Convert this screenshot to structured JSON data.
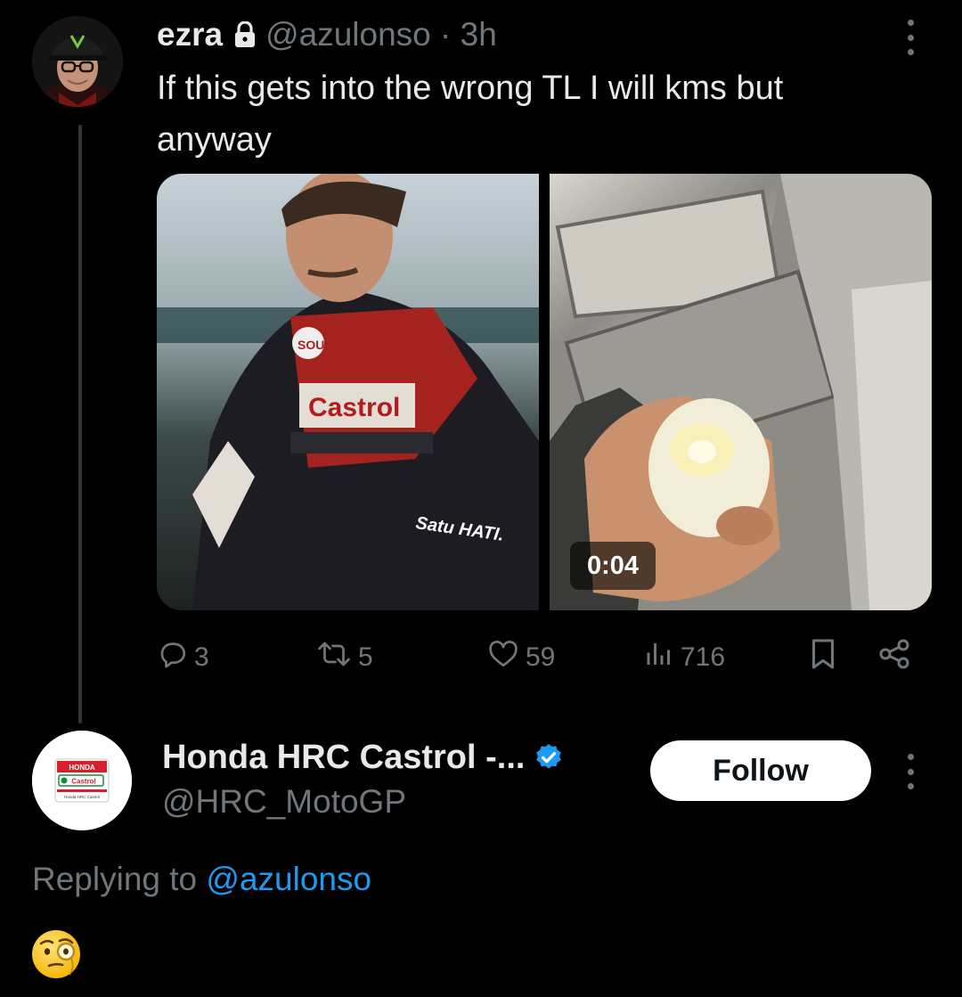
{
  "post": {
    "display_name": "ezra",
    "handle": "@azulonso",
    "separator": "·",
    "time": "3h",
    "text": "If this gets into the wrong TL I will kms but anyway",
    "media": {
      "video_duration": "0:04"
    },
    "actions": {
      "replies": "3",
      "reposts": "5",
      "likes": "59",
      "views": "716"
    }
  },
  "reply": {
    "display_name": "Honda HRC Castrol -...",
    "handle": "@HRC_MotoGP",
    "follow_label": "Follow",
    "replying_prefix": "Replying to",
    "replying_to": "@azulonso",
    "avatar_logo": {
      "brand": "HONDA",
      "sponsor": "Castrol",
      "tagline": "Honda HRC Castrol"
    },
    "emoji_icon": "face-with-monocle"
  },
  "colors": {
    "background": "#000000",
    "text_primary": "#e7e9ea",
    "text_secondary": "#71767b",
    "link": "#1d9bf0",
    "verified": "#1d9bf0"
  },
  "icons": [
    "lock-icon",
    "more-icon",
    "reply-icon",
    "repost-icon",
    "like-icon",
    "views-icon",
    "bookmark-icon",
    "share-icon",
    "verified-icon"
  ]
}
